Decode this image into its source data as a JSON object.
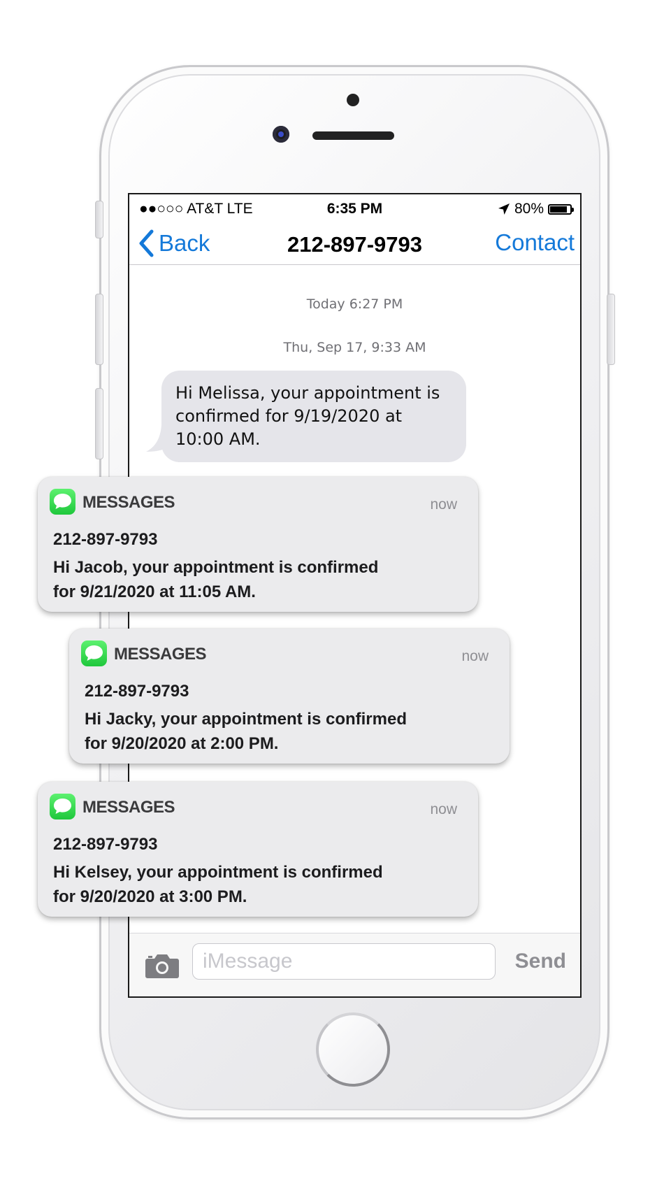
{
  "status_bar": {
    "carrier": "●●○○○ AT&T LTE",
    "time": "6:35 PM",
    "battery": "80%"
  },
  "nav": {
    "back_label": "Back",
    "title": "212-897-9793",
    "contact_label": "Contact"
  },
  "conversation": {
    "timestamp_1": "Today 6:27 PM",
    "timestamp_2": "Thu, Sep 17, 9:33 AM",
    "message_1": "Hi Melissa, your appointment is confirmed for 9/19/2020 at 10:00 AM."
  },
  "notifications": [
    {
      "app": "MESSAGES",
      "time": "now",
      "sender": "212-897-9793",
      "body": "Hi Jacob, your appointment is confirmed for 9/21/2020 at 11:05 AM."
    },
    {
      "app": "MESSAGES",
      "time": "now",
      "sender": "212-897-9793",
      "body": "Hi Jacky, your appointment is confirmed for 9/20/2020 at 2:00 PM."
    },
    {
      "app": "MESSAGES",
      "time": "now",
      "sender": "212-897-9793",
      "body": "Hi Kelsey, your appointment is confirmed for 9/20/2020 at 3:00 PM."
    }
  ],
  "composer": {
    "placeholder": "iMessage",
    "send_label": "Send"
  },
  "colors": {
    "accent": "#1479d9",
    "messages_green": "#2bd148",
    "bubble_gray": "#e5e5ea"
  },
  "icons": [
    "back-chevron-icon",
    "location-arrow-icon",
    "battery-icon",
    "camera-icon",
    "messages-app-icon"
  ]
}
